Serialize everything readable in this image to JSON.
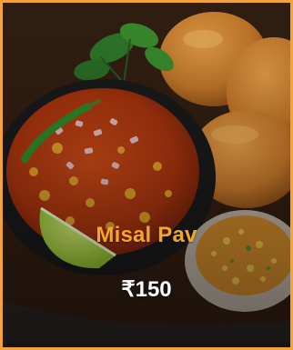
{
  "card": {
    "name": "Misal Pav",
    "price": "₹150"
  },
  "colors": {
    "border": "#f2a33a",
    "name_text": "#f5a623",
    "price_text": "#ffffff"
  },
  "image": {
    "subject": "misal-pav-dish-photo"
  }
}
